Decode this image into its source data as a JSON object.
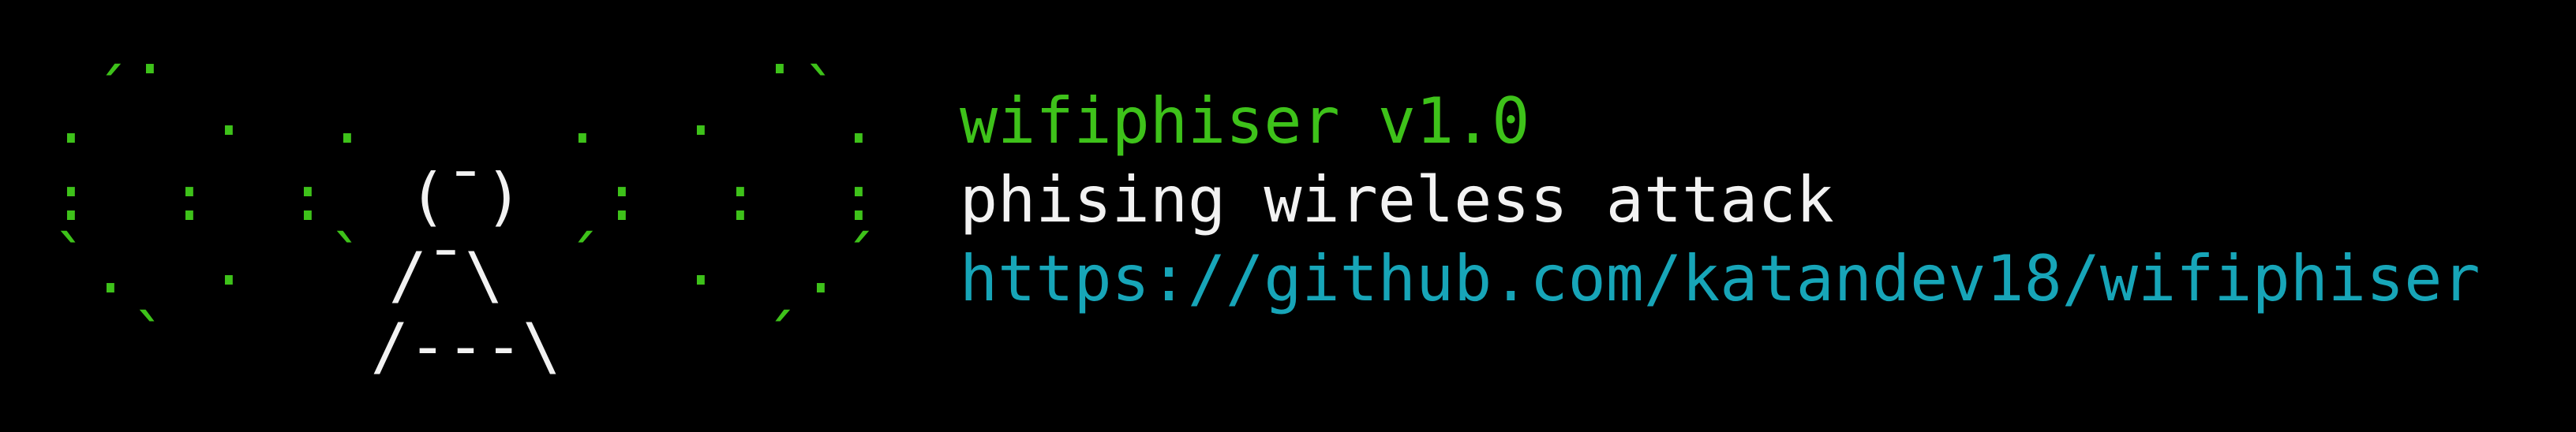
{
  "colors": {
    "background": "#000000",
    "accent_green": "#3ec21a",
    "text_white": "#f2f2f2",
    "link_cyan": "#17a5b8"
  },
  "logo": {
    "icon": "wifi-antenna-ascii-art",
    "head": "(¯)",
    "body_upper": "/¯\\",
    "body_lower": "/---\\"
  },
  "banner": {
    "title": "wifiphiser v1.0",
    "subtitle": "phising wireless attack",
    "url": "https://github.com/katandev18/wifiphiser"
  }
}
